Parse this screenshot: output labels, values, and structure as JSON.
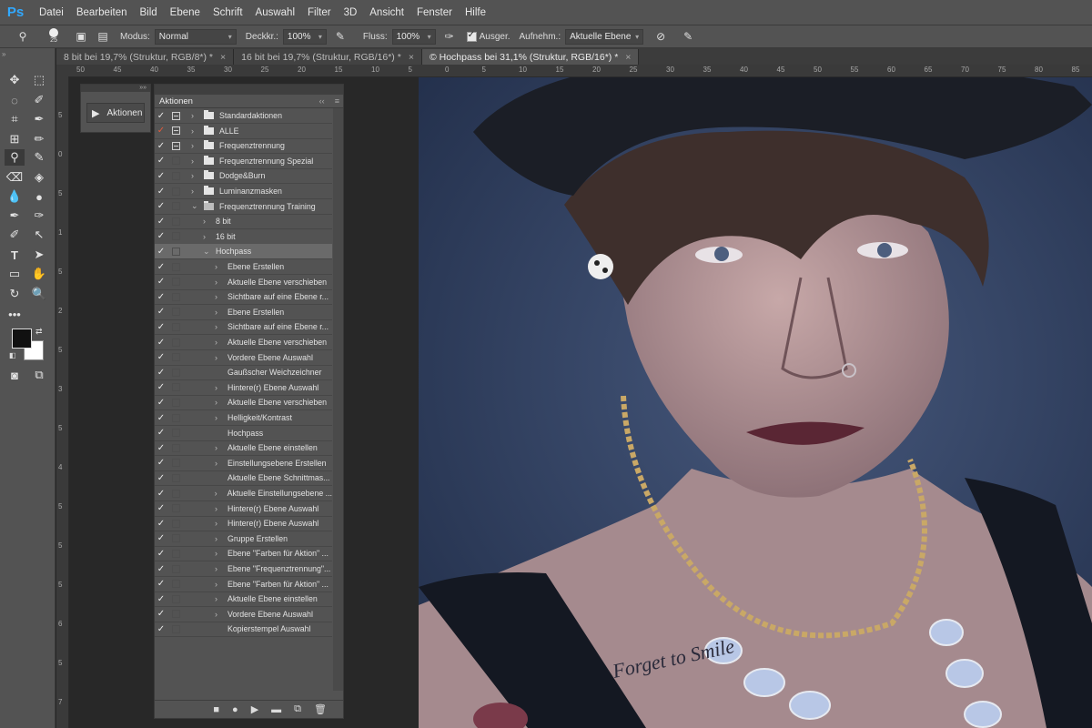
{
  "menubar": {
    "logo": "Ps",
    "items": [
      "Datei",
      "Bearbeiten",
      "Bild",
      "Ebene",
      "Schrift",
      "Auswahl",
      "Filter",
      "3D",
      "Ansicht",
      "Fenster",
      "Hilfe"
    ]
  },
  "options": {
    "brush_size": "25",
    "mode_label": "Modus:",
    "mode_value": "Normal",
    "opacity_label": "Deckkr.:",
    "opacity_value": "100%",
    "flow_label": "Fluss:",
    "flow_value": "100%",
    "aligned_label": "Ausger.",
    "sample_label": "Aufnehm.:",
    "sample_value": "Aktuelle Ebene"
  },
  "tabs": [
    {
      "label": "8 bit bei 19,7% (Struktur, RGB/8*) *"
    },
    {
      "label": "16 bit bei 19,7% (Struktur, RGB/16*) *"
    },
    {
      "label": "© Hochpass bei 31,1% (Struktur, RGB/16*) *"
    }
  ],
  "rulers": {
    "h": [
      "50",
      "45",
      "40",
      "35",
      "30",
      "25",
      "20",
      "15",
      "10",
      "5",
      "0",
      "5",
      "10",
      "15",
      "20",
      "25",
      "30",
      "35",
      "40",
      "45",
      "50",
      "55",
      "60",
      "65",
      "70",
      "75",
      "80",
      "85"
    ],
    "v": [
      "5",
      "0",
      "5",
      "1",
      "5",
      "2",
      "5",
      "3",
      "5",
      "4",
      "5",
      "5",
      "5",
      "6",
      "5",
      "7"
    ]
  },
  "collapsed_panel": {
    "label": "Aktionen"
  },
  "actions_panel": {
    "title": "Aktionen",
    "rows": [
      {
        "label": "Standardaktionen",
        "indent": 0,
        "folder": true,
        "chev": "›",
        "check": "✓",
        "dlg": "on"
      },
      {
        "label": "ALLE",
        "indent": 0,
        "folder": true,
        "chev": "›",
        "check": "✓",
        "red": true,
        "dlg": "on"
      },
      {
        "label": "Frequenztrennung",
        "indent": 0,
        "folder": true,
        "chev": "›",
        "check": "✓",
        "dlg": "on"
      },
      {
        "label": "Frequenztrennung Spezial",
        "indent": 0,
        "folder": true,
        "chev": "›",
        "check": "✓",
        "dlg": "off"
      },
      {
        "label": "Dodge&Burn",
        "indent": 0,
        "folder": true,
        "chev": "›",
        "check": "✓",
        "dlg": "off"
      },
      {
        "label": "Luminanzmasken",
        "indent": 0,
        "folder": true,
        "chev": "›",
        "check": "✓",
        "dlg": "off"
      },
      {
        "label": "Frequenztrennung Training",
        "indent": 0,
        "folder": true,
        "open": true,
        "chev": "⌄",
        "check": "✓",
        "dlg": "off"
      },
      {
        "label": "8 bit",
        "indent": 1,
        "chev": "›",
        "check": "✓",
        "dlg": "off"
      },
      {
        "label": "16 bit",
        "indent": 1,
        "chev": "›",
        "check": "✓",
        "dlg": "off"
      },
      {
        "label": "Hochpass",
        "indent": 1,
        "chev": "⌄",
        "check": "✓",
        "dlg": "off",
        "selected": true
      },
      {
        "label": "Ebene Erstellen",
        "indent": 2,
        "chev": "›",
        "check": "✓",
        "dlg": "off"
      },
      {
        "label": "Aktuelle Ebene verschieben",
        "indent": 2,
        "chev": "›",
        "check": "✓",
        "dlg": "off"
      },
      {
        "label": "Sichtbare auf eine Ebene r...",
        "indent": 2,
        "chev": "›",
        "check": "✓",
        "dlg": "off"
      },
      {
        "label": "Ebene Erstellen",
        "indent": 2,
        "chev": "›",
        "check": "✓",
        "dlg": "off"
      },
      {
        "label": "Sichtbare auf eine Ebene r...",
        "indent": 2,
        "chev": "›",
        "check": "✓",
        "dlg": "off"
      },
      {
        "label": "Aktuelle Ebene verschieben",
        "indent": 2,
        "chev": "›",
        "check": "✓",
        "dlg": "off"
      },
      {
        "label": "Vordere Ebene Auswahl",
        "indent": 2,
        "chev": "›",
        "check": "✓",
        "dlg": "off"
      },
      {
        "label": "Gaußscher Weichzeichner",
        "indent": 2,
        "chev": "",
        "check": "✓",
        "dlg": "off"
      },
      {
        "label": "Hintere(r) Ebene Auswahl",
        "indent": 2,
        "chev": "›",
        "check": "✓",
        "dlg": "off"
      },
      {
        "label": "Aktuelle Ebene verschieben",
        "indent": 2,
        "chev": "›",
        "check": "✓",
        "dlg": "off"
      },
      {
        "label": "Helligkeit/Kontrast",
        "indent": 2,
        "chev": "›",
        "check": "✓",
        "dlg": "off"
      },
      {
        "label": "Hochpass",
        "indent": 2,
        "chev": "",
        "check": "✓",
        "dlg": "off"
      },
      {
        "label": "Aktuelle Ebene einstellen",
        "indent": 2,
        "chev": "›",
        "check": "✓",
        "dlg": "off"
      },
      {
        "label": "Einstellungsebene Erstellen",
        "indent": 2,
        "chev": "›",
        "check": "✓",
        "dlg": "off"
      },
      {
        "label": "Aktuelle Ebene Schnittmas...",
        "indent": 2,
        "chev": "",
        "check": "✓",
        "dlg": "off"
      },
      {
        "label": "Aktuelle Einstellungsebene ...",
        "indent": 2,
        "chev": "›",
        "check": "✓",
        "dlg": "off"
      },
      {
        "label": "Hintere(r) Ebene Auswahl",
        "indent": 2,
        "chev": "›",
        "check": "✓",
        "dlg": "off"
      },
      {
        "label": "Hintere(r) Ebene Auswahl",
        "indent": 2,
        "chev": "›",
        "check": "✓",
        "dlg": "off"
      },
      {
        "label": "Gruppe Erstellen",
        "indent": 2,
        "chev": "›",
        "check": "✓",
        "dlg": "off"
      },
      {
        "label": "Ebene \"Farben für Aktion\" ...",
        "indent": 2,
        "chev": "›",
        "check": "✓",
        "dlg": "off"
      },
      {
        "label": "Ebene \"Frequenztrennung\"...",
        "indent": 2,
        "chev": "›",
        "check": "✓",
        "dlg": "off"
      },
      {
        "label": "Ebene \"Farben für Aktion\" ...",
        "indent": 2,
        "chev": "›",
        "check": "✓",
        "dlg": "off"
      },
      {
        "label": "Aktuelle Ebene einstellen",
        "indent": 2,
        "chev": "›",
        "check": "✓",
        "dlg": "off"
      },
      {
        "label": "Vordere Ebene Auswahl",
        "indent": 2,
        "chev": "›",
        "check": "✓",
        "dlg": "off"
      },
      {
        "label": "Kopierstempel Auswahl",
        "indent": 2,
        "chev": "",
        "check": "✓",
        "dlg": "off"
      }
    ],
    "footer": [
      "stop-icon",
      "record-icon",
      "play-icon",
      "new-set-icon",
      "new-action-icon",
      "trash-icon"
    ]
  },
  "photo": {
    "tattoo_text": "Forget to Smile"
  },
  "colors": {
    "bg": "#282828",
    "panel": "#535353",
    "accent": "#31a8ff",
    "photo_bg": "#2f3f5e"
  }
}
